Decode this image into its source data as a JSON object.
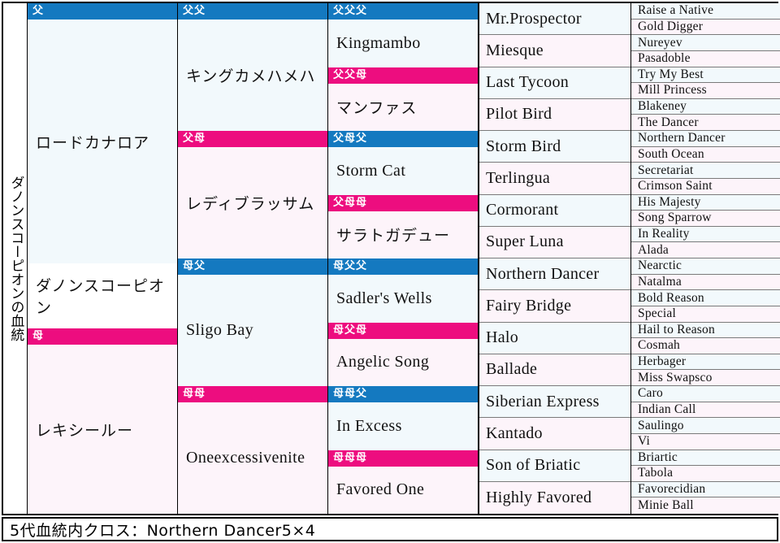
{
  "title_vertical": "ダノンスコーピオンの血統",
  "footer": {
    "text": "5代血統内クロス：Northern Dancer5×4"
  },
  "labels": {
    "sire": "父",
    "dam": "母",
    "sire_sire": "父父",
    "sire_dam": "父母",
    "dam_sire": "母父",
    "dam_dam": "母母",
    "sire_sire_sire": "父父父",
    "sire_sire_dam": "父父母",
    "sire_dam_sire": "父母父",
    "sire_dam_dam": "父母母",
    "dam_sire_sire": "母父父",
    "dam_sire_dam": "母父母",
    "dam_dam_sire": "母母父",
    "dam_dam_dam": "母母母"
  },
  "gen1": [
    {
      "tag": "父",
      "tag_type": "m",
      "name": "ロードカナロア",
      "lang": "jp",
      "bg": "bgm"
    },
    {
      "tag": "",
      "tag_type": "none",
      "name": "ダノンスコーピオン",
      "lang": "jp",
      "bg": "bgw"
    },
    {
      "tag": "母",
      "tag_type": "f",
      "name": "レキシールー",
      "lang": "jp",
      "bg": "bgf"
    }
  ],
  "gen2": [
    {
      "tag": "父父",
      "tag_type": "m",
      "name": "キングカメハメハ",
      "lang": "jp",
      "bg": "bgm"
    },
    {
      "tag": "父母",
      "tag_type": "f",
      "name": "レディブラッサム",
      "lang": "jp",
      "bg": "bgf"
    },
    {
      "tag": "母父",
      "tag_type": "m",
      "name": "Sligo Bay",
      "lang": "en",
      "bg": "bgm"
    },
    {
      "tag": "母母",
      "tag_type": "f",
      "name": "Oneexcessivenite",
      "lang": "en",
      "bg": "bgf"
    }
  ],
  "gen3": [
    {
      "tag": "父父父",
      "tag_type": "m",
      "name": "Kingmambo",
      "lang": "en",
      "bg": "bgm"
    },
    {
      "tag": "父父母",
      "tag_type": "f",
      "name": "マンファス",
      "lang": "jp",
      "bg": "bgf"
    },
    {
      "tag": "父母父",
      "tag_type": "m",
      "name": "Storm Cat",
      "lang": "en",
      "bg": "bgm"
    },
    {
      "tag": "父母母",
      "tag_type": "f",
      "name": "サラトガデュー",
      "lang": "jp",
      "bg": "bgf"
    },
    {
      "tag": "母父父",
      "tag_type": "m",
      "name": "Sadler's Wells",
      "lang": "en",
      "bg": "bgm"
    },
    {
      "tag": "母父母",
      "tag_type": "f",
      "name": "Angelic Song",
      "lang": "en",
      "bg": "bgf"
    },
    {
      "tag": "母母父",
      "tag_type": "m",
      "name": "In Excess",
      "lang": "en",
      "bg": "bgm"
    },
    {
      "tag": "母母母",
      "tag_type": "f",
      "name": "Favored One",
      "lang": "en",
      "bg": "bgf"
    }
  ],
  "gen4": [
    {
      "name": "Mr.Prospector",
      "bg": "bgm"
    },
    {
      "name": "Miesque",
      "bg": "bgf"
    },
    {
      "name": "Last Tycoon",
      "bg": "bgm"
    },
    {
      "name": "Pilot Bird",
      "bg": "bgf"
    },
    {
      "name": "Storm Bird",
      "bg": "bgm"
    },
    {
      "name": "Terlingua",
      "bg": "bgf"
    },
    {
      "name": "Cormorant",
      "bg": "bgm"
    },
    {
      "name": "Super Luna",
      "bg": "bgf"
    },
    {
      "name": "Northern Dancer",
      "bg": "bgm"
    },
    {
      "name": "Fairy Bridge",
      "bg": "bgf"
    },
    {
      "name": "Halo",
      "bg": "bgm"
    },
    {
      "name": "Ballade",
      "bg": "bgf"
    },
    {
      "name": "Siberian Express",
      "bg": "bgm"
    },
    {
      "name": "Kantado",
      "bg": "bgf"
    },
    {
      "name": "Son of Briatic",
      "bg": "bgm"
    },
    {
      "name": "Highly Favored",
      "bg": "bgf"
    }
  ],
  "gen5": [
    {
      "name": "Raise a Native",
      "bg": "bgm"
    },
    {
      "name": "Gold Digger",
      "bg": "bgf"
    },
    {
      "name": "Nureyev",
      "bg": "bgm"
    },
    {
      "name": "Pasadoble",
      "bg": "bgf"
    },
    {
      "name": "Try My Best",
      "bg": "bgm"
    },
    {
      "name": "Mill Princess",
      "bg": "bgf"
    },
    {
      "name": "Blakeney",
      "bg": "bgm"
    },
    {
      "name": "The Dancer",
      "bg": "bgf"
    },
    {
      "name": "Northern Dancer",
      "bg": "bgm"
    },
    {
      "name": "South Ocean",
      "bg": "bgf"
    },
    {
      "name": "Secretariat",
      "bg": "bgm"
    },
    {
      "name": "Crimson Saint",
      "bg": "bgf"
    },
    {
      "name": "His Majesty",
      "bg": "bgm"
    },
    {
      "name": "Song Sparrow",
      "bg": "bgf"
    },
    {
      "name": "In Reality",
      "bg": "bgm"
    },
    {
      "name": "Alada",
      "bg": "bgf"
    },
    {
      "name": "Nearctic",
      "bg": "bgm"
    },
    {
      "name": "Natalma",
      "bg": "bgf"
    },
    {
      "name": "Bold Reason",
      "bg": "bgm"
    },
    {
      "name": "Special",
      "bg": "bgf"
    },
    {
      "name": "Hail to Reason",
      "bg": "bgm"
    },
    {
      "name": "Cosmah",
      "bg": "bgf"
    },
    {
      "name": "Herbager",
      "bg": "bgm"
    },
    {
      "name": "Miss Swapsco",
      "bg": "bgf"
    },
    {
      "name": "Caro",
      "bg": "bgm"
    },
    {
      "name": "Indian Call",
      "bg": "bgf"
    },
    {
      "name": "Saulingo",
      "bg": "bgm"
    },
    {
      "name": "Vi",
      "bg": "bgf"
    },
    {
      "name": "Briartic",
      "bg": "bgm"
    },
    {
      "name": "Tabola",
      "bg": "bgf"
    },
    {
      "name": "Favorecidian",
      "bg": "bgm"
    },
    {
      "name": "Minie Ball",
      "bg": "bgf"
    }
  ],
  "colors": {
    "sire_bar": "#1479c0",
    "dam_bar": "#ed0d7f",
    "sire_cell": "#f2f9fc",
    "dam_cell": "#fdf4fa",
    "border": "#000000"
  }
}
